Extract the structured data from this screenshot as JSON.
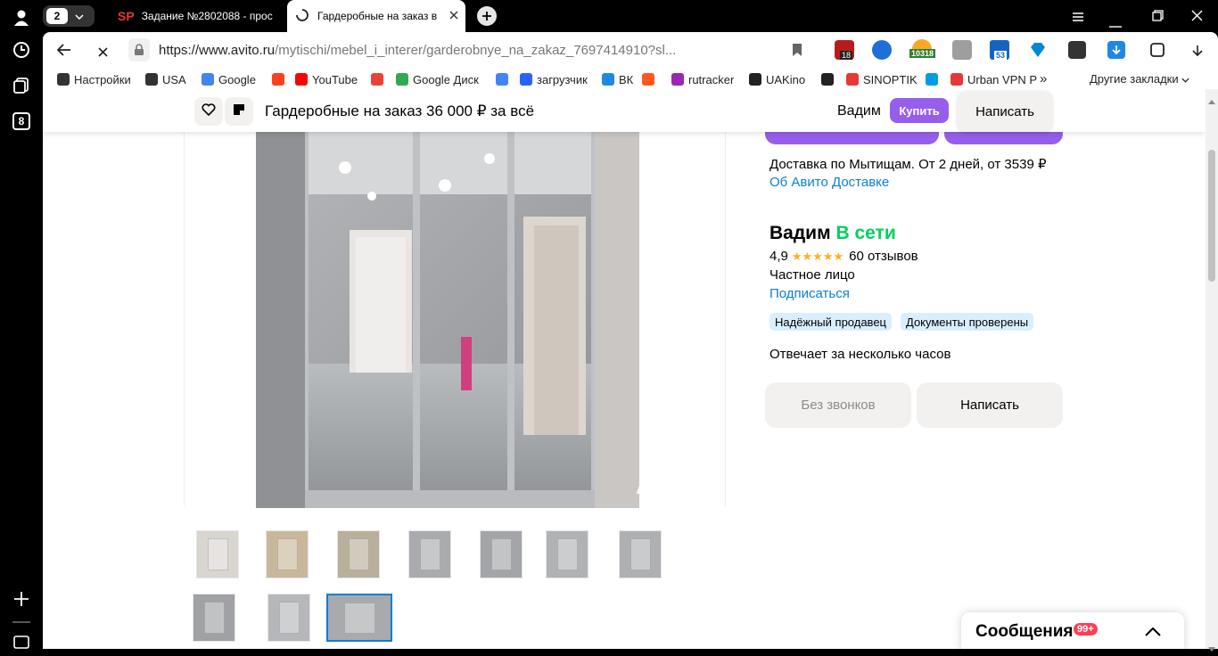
{
  "browser": {
    "tab_count": "2",
    "tabs": [
      {
        "title": "Задание №2802088 - прос",
        "favicon_text": "SP"
      },
      {
        "title": "Гардеробные на заказ в"
      }
    ],
    "url_domain": "https://www.avito.ru",
    "url_path": "/mytischi/mebel_i_interer/garderobnye_na_zakaz_7697414910?sl...",
    "ext_badges": [
      "18",
      "10318",
      "53"
    ],
    "side_badge": "8"
  },
  "bookmarks": [
    {
      "label": "Настройки",
      "icon": "gear-icon",
      "color": "#333333"
    },
    {
      "label": "USA",
      "icon": "folder-chevron",
      "color": "#333333"
    },
    {
      "label": "Google",
      "icon": "google-icon",
      "color": "#4285f4"
    },
    {
      "label": "",
      "icon": "yandex-icon",
      "color": "#fc3f1d"
    },
    {
      "label": "YouTube",
      "icon": "youtube-icon",
      "color": "#ff0000"
    },
    {
      "label": "",
      "icon": "gmail-icon",
      "color": "#ea4335"
    },
    {
      "label": "Google Диск",
      "icon": "drive-icon",
      "color": "#34a853"
    },
    {
      "label": "",
      "icon": "translate-icon",
      "color": "#4285f4"
    },
    {
      "label": "загрузчик",
      "icon": "loader-icon",
      "color": "#2962ff"
    },
    {
      "label": "ВК",
      "icon": "vk-icon",
      "color": "#1e88e5"
    },
    {
      "label": "",
      "icon": "f-icon",
      "color": "#ff5722"
    },
    {
      "label": "rutracker",
      "icon": "rutracker-icon",
      "color": "#9c27b0"
    },
    {
      "label": "UAKino",
      "icon": "uakino-icon",
      "color": "#222222"
    },
    {
      "label": "",
      "icon": "chess-icon",
      "color": "#222222"
    },
    {
      "label": "SINOPTIK",
      "icon": "thermometer-icon",
      "color": "#e53935"
    },
    {
      "label": "",
      "icon": "p-icon",
      "color": "#039be5"
    },
    {
      "label": "Urban VPN P",
      "icon": "vpn-icon",
      "color": "#e53935"
    }
  ],
  "bookmarks_more": "»",
  "other_bookmarks": "Другие закладки",
  "sticky": {
    "title": "Гардеробные на заказ",
    "price": "36 000 ₽ за всё",
    "seller": "Вадим",
    "buy": "Купить",
    "write": "Написать"
  },
  "seller": {
    "delivery": "Доставка по Мытищам. От 2 дней, от 3539 ₽",
    "delivery_link": "Об Авито Доставке",
    "name": "Вадим",
    "online": "В сети",
    "rating": "4,9",
    "stars": "★★★★★",
    "reviews": "60 отзывов",
    "type": "Частное лицо",
    "subscribe": "Подписаться",
    "badges": [
      "Надёжный продавец",
      "Документы проверены"
    ],
    "response": "Отвечает за несколько часов",
    "no_calls": "Без звонков",
    "write": "Написать"
  },
  "gallery": {
    "watermark": "Avito",
    "thumbs_row1": 7,
    "thumbs_row2": 3,
    "selected_index": 9
  },
  "messages": {
    "label": "Сообщения",
    "badge": "99+"
  },
  "colors": {
    "accent_purple": "#965eeb",
    "link_blue": "#0a7ed8",
    "online_green": "#02d15c",
    "badge_bg": "#d9efff",
    "star": "#ffb021",
    "badge_red": "#ff4053"
  }
}
